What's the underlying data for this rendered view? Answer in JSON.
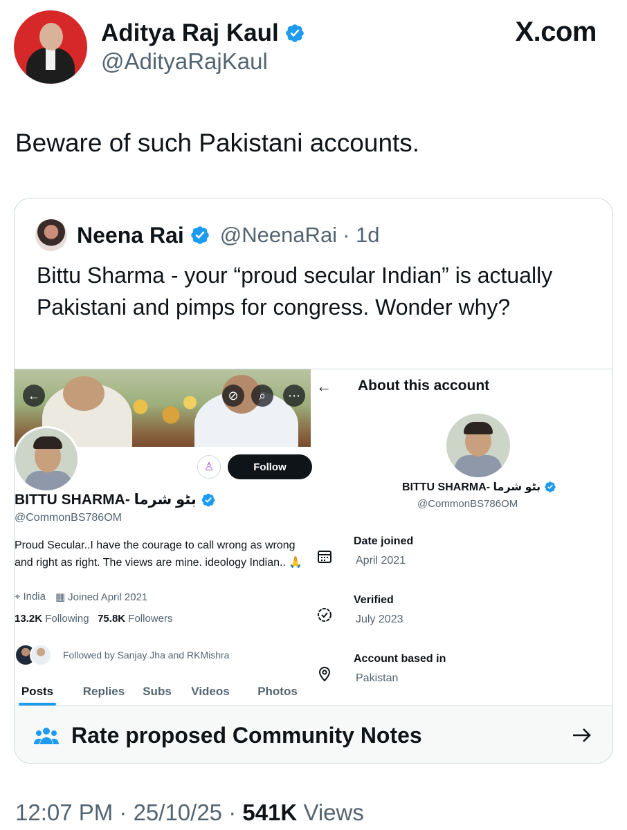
{
  "author": {
    "name": "Aditya Raj Kaul",
    "handle": "@AdityaRajKaul"
  },
  "brand": "X.com",
  "tweet_text": "Beware of such Pakistani accounts.",
  "quote": {
    "name": "Neena Rai",
    "handle": "@NeenaRai",
    "time": "· 1d",
    "text": "Bittu Sharma - your “proud secular Indian” is actually Pakistani and pimps for congress. Wonder why?"
  },
  "profile": {
    "follow_label": "Follow",
    "name": "BITTU SHARMA- بٹو شرما",
    "handle": "@CommonBS786OM",
    "bio": "Proud Secular..I have the courage to call wrong as wrong and right as right. The views are mine. ideology Indian.. 🙏",
    "location": "India",
    "joined": "Joined April 2021",
    "following_count": "13.2K",
    "following_label": "Following",
    "followers_count": "75.8K",
    "followers_label": "Followers",
    "followed_by": "Followed by Sanjay Jha and RKMishra",
    "tabs": [
      "Posts",
      "Replies",
      "Subs",
      "Videos",
      "Photos"
    ],
    "active_tab": "Posts"
  },
  "about": {
    "title": "About this account",
    "name": "BITTU SHARMA- بٹو شرما",
    "handle": "@CommonBS786OM",
    "rows": [
      {
        "label": "Date joined",
        "value": "April 2021",
        "icon": "calendar-icon"
      },
      {
        "label": "Verified",
        "value": "July 2023",
        "icon": "verified-badge-icon"
      },
      {
        "label": "Account based in",
        "value": "Pakistan",
        "icon": "location-pin-icon"
      }
    ]
  },
  "community_notes": {
    "label": "Rate proposed Community Notes"
  },
  "footer": {
    "time": "12:07 PM",
    "date": "25/10/25",
    "views_count": "541K",
    "views_label": "Views"
  },
  "colors": {
    "accent": "#1d9bf0",
    "text": "#0f1419",
    "muted": "#536471",
    "border": "#cfd9de"
  }
}
